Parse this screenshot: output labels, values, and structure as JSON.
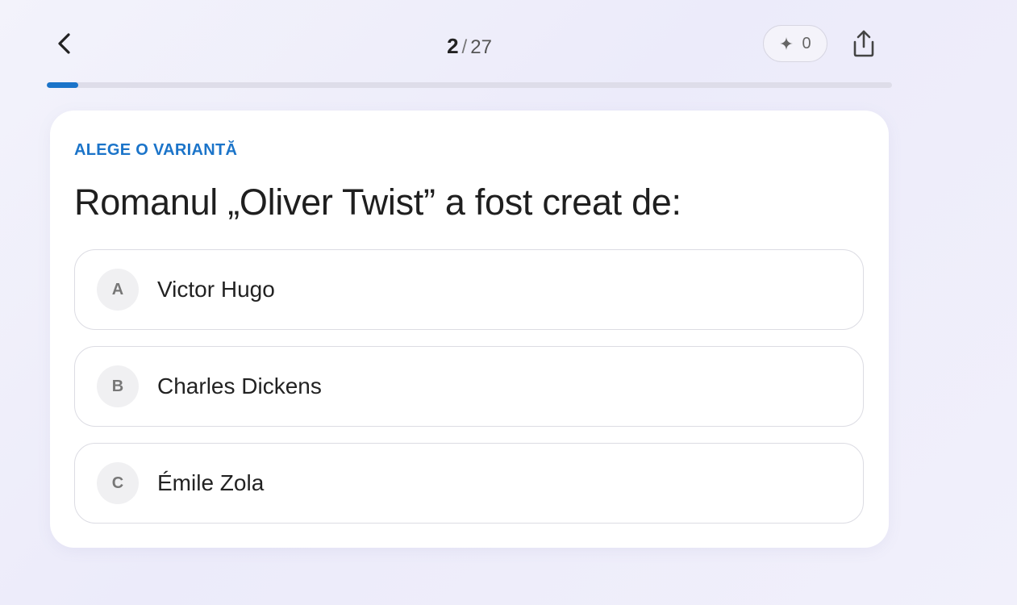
{
  "header": {
    "current": "2",
    "separator": "/",
    "total": "27",
    "hint_count": "0",
    "hint_icon": "sparkle-icon",
    "back_icon": "chevron-left-icon",
    "share_icon": "share-icon"
  },
  "progress": {
    "value": 0.037,
    "accent": "#1b74c9"
  },
  "card": {
    "label": "ALEGE O VARIANTĂ",
    "question": "Romanul „Oliver Twist” a fost creat de:",
    "options": [
      {
        "letter": "A",
        "text": "Victor Hugo"
      },
      {
        "letter": "B",
        "text": "Charles Dickens"
      },
      {
        "letter": "C",
        "text": "Émile Zola"
      }
    ]
  }
}
